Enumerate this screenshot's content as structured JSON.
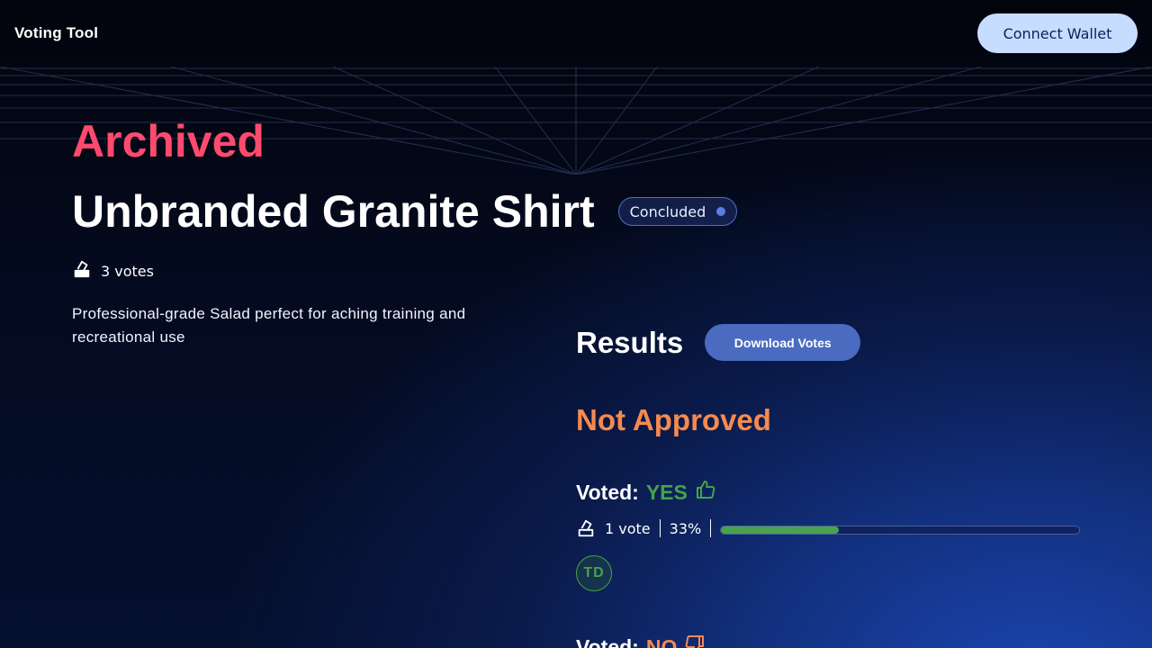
{
  "header": {
    "brand": "Voting Tool",
    "connect_label": "Connect Wallet"
  },
  "proposal": {
    "status": "Archived",
    "title": "Unbranded Granite Shirt",
    "badge": "Concluded",
    "total_votes": "3 votes",
    "description": "Professional-grade Salad perfect for aching training and recreational use"
  },
  "results": {
    "heading": "Results",
    "download_label": "Download Votes",
    "outcome": "Not Approved",
    "yes": {
      "voted_label": "Voted:",
      "choice": "YES",
      "count": "1 vote",
      "percent": "33%",
      "fill_percent": 33,
      "voters": [
        "TD"
      ]
    },
    "no": {
      "voted_label": "Voted:",
      "choice": "NO"
    }
  },
  "colors": {
    "archived": "#ff4a6e",
    "not_approved": "#f58a4f",
    "yes": "#45a34a",
    "accent_button": "#4a6bc0",
    "connect_button": "#c6ddff"
  },
  "icons": [
    "ballot-box-icon",
    "thumbs-up-icon",
    "thumbs-down-icon",
    "status-dot-icon"
  ]
}
